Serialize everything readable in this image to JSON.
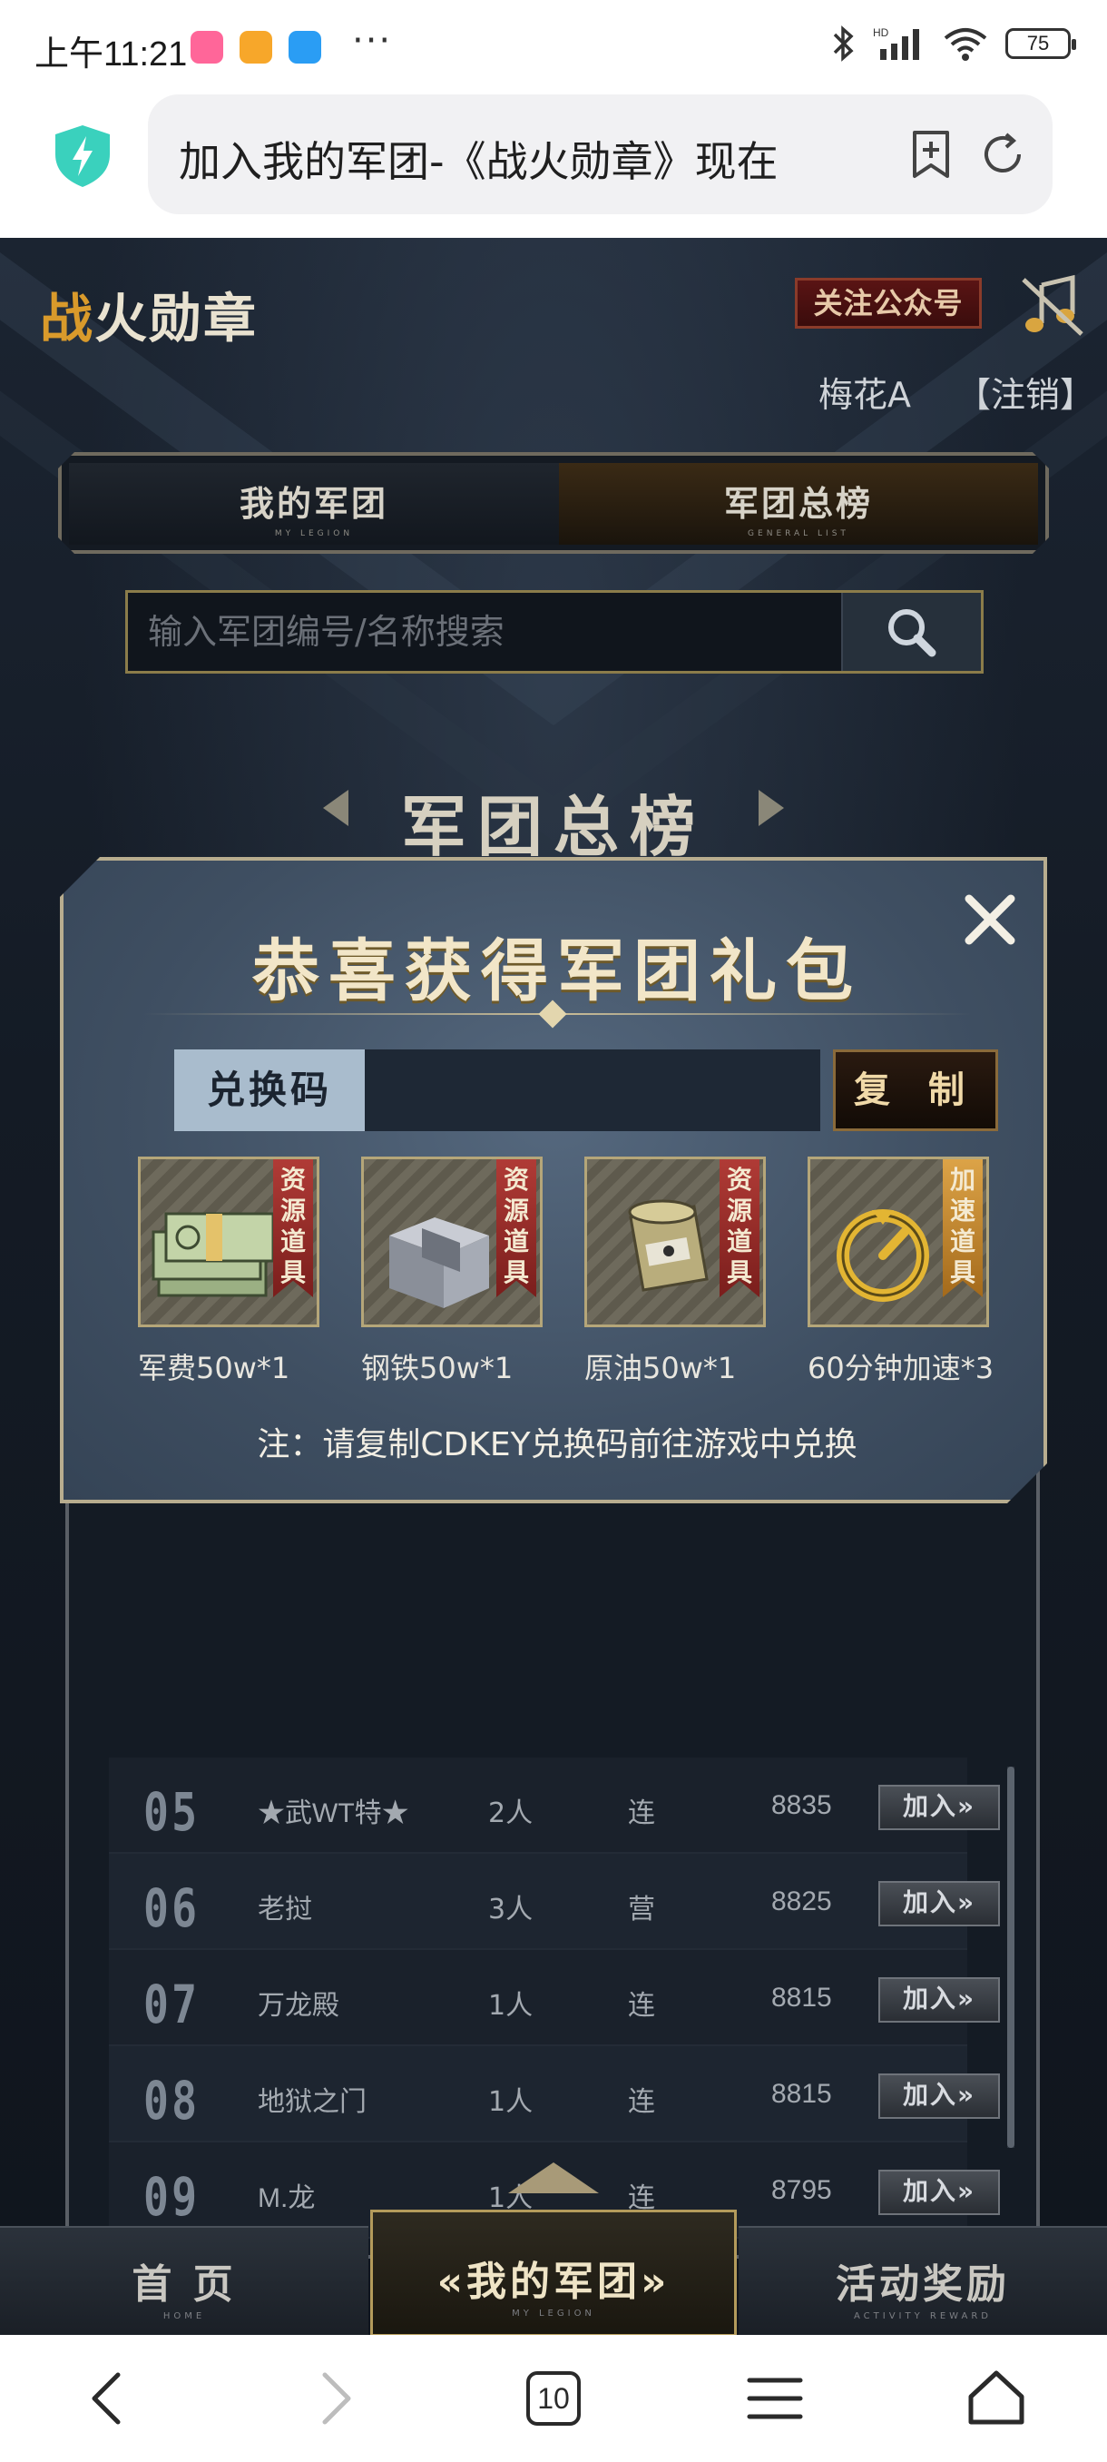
{
  "status_bar": {
    "time": "上午11:21",
    "more": "···",
    "battery": "75",
    "app_icons": [
      {
        "name": "bilibili-app-icon",
        "color": "#ff6699"
      },
      {
        "name": "notes-app-icon",
        "color": "#f7a72a"
      },
      {
        "name": "upload-app-icon",
        "color": "#2a9df4"
      }
    ]
  },
  "browser": {
    "url_title": "加入我的军团-《战火勋章》现在",
    "tab_count": "10"
  },
  "game": {
    "logo_first": "战",
    "logo_rest": "火勋章",
    "follow_button": "关注公众号",
    "user_name": "梅花A",
    "logout": "【注销】",
    "tabs": [
      {
        "label": "我的军团",
        "sub": "MY LEGION"
      },
      {
        "label": "军团总榜",
        "sub": "GENERAL LIST"
      }
    ],
    "search": {
      "placeholder": "输入军团编号/名称搜索"
    },
    "section_title": "军团总榜",
    "ranking": [
      {
        "rank": "05",
        "name": "★武WT特★",
        "members": "2人",
        "type": "连",
        "score": "8835",
        "join": "加入»"
      },
      {
        "rank": "06",
        "name": "老挝",
        "members": "3人",
        "type": "营",
        "score": "8825",
        "join": "加入»"
      },
      {
        "rank": "07",
        "name": "万龙殿",
        "members": "1人",
        "type": "连",
        "score": "8815",
        "join": "加入»"
      },
      {
        "rank": "08",
        "name": "地狱之门",
        "members": "1人",
        "type": "连",
        "score": "8815",
        "join": "加入»"
      },
      {
        "rank": "09",
        "name": "M.龙",
        "members": "1人",
        "type": "连",
        "score": "8795",
        "join": "加入»"
      }
    ],
    "modal": {
      "title": "恭喜获得军团礼包",
      "code_label": "兑换码",
      "code_value": "",
      "copy_button": "复 制",
      "items": [
        {
          "name": "军费50w*1",
          "tag": "资源道具",
          "icon": "money-stack-icon",
          "tag_color": "#b03b36"
        },
        {
          "name": "钢铁50w*1",
          "tag": "资源道具",
          "icon": "steel-block-icon",
          "tag_color": "#b03b36"
        },
        {
          "name": "原油50w*1",
          "tag": "资源道具",
          "icon": "oil-barrel-icon",
          "tag_color": "#b03b36"
        },
        {
          "name": "60分钟加速*3",
          "tag": "加速道具",
          "icon": "speedup-clock-icon",
          "tag_color": "#dca347"
        }
      ],
      "note": "注：请复制CDKEY兑换码前往游戏中兑换"
    },
    "nav": [
      {
        "label": "首 页",
        "sub": "HOME"
      },
      {
        "label": "«我的军团»",
        "sub": "MY LEGION"
      },
      {
        "label": "活动奖励",
        "sub": "ACTIVITY REWARD"
      }
    ]
  }
}
